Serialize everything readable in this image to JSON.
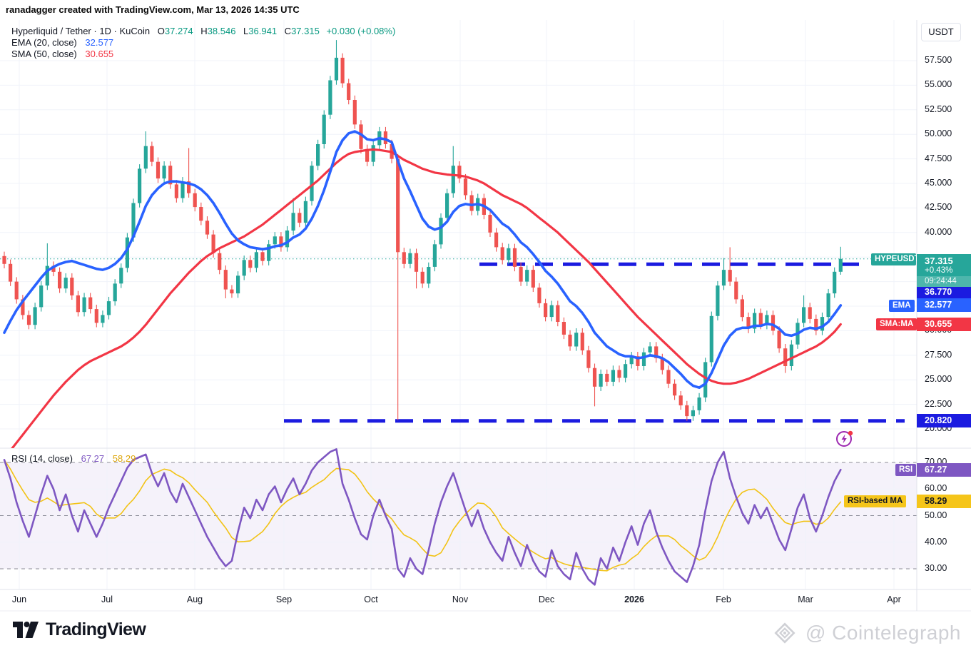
{
  "attribution": "ranadagger created with TradingView.com, Mar 13, 2026 14:35 UTC",
  "header": {
    "symbol_title": "Hyperliquid / Tether · 1D · KuCoin",
    "ohlc": {
      "o_label": "O",
      "o": "37.274",
      "h_label": "H",
      "h": "38.546",
      "l_label": "L",
      "l": "36.941",
      "c_label": "C",
      "c": "37.315",
      "change": "+0.030 (+0.08%)"
    },
    "ema_legend": {
      "name": "EMA (20, close)",
      "value": "32.577"
    },
    "sma_legend": {
      "name": "SMA (50, close)",
      "value": "30.655"
    }
  },
  "rsi_legend": {
    "name": "RSI (14, close)",
    "value": "67.27",
    "ma_value": "58.29"
  },
  "price_axis": {
    "currency_button": "USDT",
    "ticks": [
      {
        "label": "57.500",
        "value": 57.5
      },
      {
        "label": "55.000",
        "value": 55
      },
      {
        "label": "52.500",
        "value": 52.5
      },
      {
        "label": "50.000",
        "value": 50
      },
      {
        "label": "47.500",
        "value": 47.5
      },
      {
        "label": "45.000",
        "value": 45
      },
      {
        "label": "42.500",
        "value": 42.5
      },
      {
        "label": "40.000",
        "value": 40
      },
      {
        "label": "30.000",
        "value": 30
      },
      {
        "label": "27.500",
        "value": 27.5
      },
      {
        "label": "25.000",
        "value": 25
      },
      {
        "label": "22.500",
        "value": 22.5
      },
      {
        "label": "20.000",
        "value": 20
      }
    ],
    "price_label": {
      "tag": "HYPEUSDT",
      "price": "37.315",
      "change_pct": "+0.43%",
      "countdown": "09:24:44",
      "value": 37.315
    },
    "line_label": {
      "price": "36.770",
      "value": 36.77
    },
    "ema_label": {
      "tag": "EMA",
      "price": "32.577",
      "value": 32.577
    },
    "sma_label": {
      "tag": "SMA:MA",
      "price": "30.655",
      "value": 30.655
    },
    "support_label": {
      "price": "20.820",
      "value": 20.82
    }
  },
  "rsi_axis": {
    "ticks": [
      {
        "label": "70.00",
        "value": 70
      },
      {
        "label": "60.00",
        "value": 60
      },
      {
        "label": "50.00",
        "value": 50
      },
      {
        "label": "40.00",
        "value": 40
      },
      {
        "label": "30.00",
        "value": 30
      }
    ],
    "rsi_label": {
      "tag": "RSI",
      "value": "67.27",
      "num": 67.27
    },
    "ma_label": {
      "tag": "RSI-based MA",
      "value": "58.29",
      "num": 55.5
    }
  },
  "time_axis": {
    "labels": [
      {
        "label": "Jun",
        "bold": false
      },
      {
        "label": "Jul",
        "bold": false
      },
      {
        "label": "Aug",
        "bold": false
      },
      {
        "label": "Sep",
        "bold": false
      },
      {
        "label": "Oct",
        "bold": false
      },
      {
        "label": "Nov",
        "bold": false
      },
      {
        "label": "Dec",
        "bold": false
      },
      {
        "label": "2026",
        "bold": true
      },
      {
        "label": "Feb",
        "bold": false
      },
      {
        "label": "Mar",
        "bold": false
      },
      {
        "label": "Apr",
        "bold": false
      }
    ]
  },
  "footer": {
    "logo_text": "TradingView",
    "watermark": "@ Cointelegraph"
  },
  "colors": {
    "up": "#26a69a",
    "down": "#ef5350",
    "header_value": "#089981",
    "ema": "#2962ff",
    "sma": "#f23645",
    "drawing_blue": "#1b1be0",
    "rsi": "#7e57c2",
    "rsi_ma": "#f0b90b",
    "rsi_ma_label_bg": "#f5c51a",
    "grid": "#f0f3fa",
    "band_dash": "#787b86",
    "axis_text": "#131722",
    "price_tag_bg": "#26a69a",
    "watermark_gray": "#cfd0d5"
  },
  "chart_data": {
    "type": "candlestick",
    "symbol": "HYPEUSDT",
    "exchange": "KuCoin",
    "interval": "1D",
    "title": "Hyperliquid / Tether · 1D · KuCoin",
    "ylim": [
      18,
      60.5
    ],
    "price_gridlines": [
      20,
      22.5,
      25,
      27.5,
      30,
      32.5,
      35,
      37.5,
      40,
      42.5,
      45,
      47.5,
      50,
      52.5,
      55,
      57.5
    ],
    "x_months": [
      "Jun",
      "Jul",
      "Aug",
      "Sep",
      "Oct",
      "Nov",
      "Dec",
      "2026",
      "Feb",
      "Mar",
      "Apr"
    ],
    "last_ohlc": {
      "open": 37.274,
      "high": 38.546,
      "low": 36.941,
      "close": 37.315,
      "change": 0.03,
      "change_pct": 0.08
    },
    "levels": {
      "resistance": 36.77,
      "support": 20.82,
      "last_price": 37.315
    },
    "candles": {
      "first_open": 37.6,
      "default_wick": 0.45,
      "closes": [
        36.8,
        35.0,
        33.2,
        31.6,
        30.6,
        32.4,
        34.6,
        36.6,
        36.0,
        34.3,
        35.4,
        33.6,
        31.9,
        33.4,
        32.2,
        30.8,
        31.6,
        33.0,
        34.8,
        36.4,
        39.5,
        43.0,
        46.5,
        48.8,
        47.2,
        45.5,
        46.8,
        44.9,
        43.5,
        45.2,
        44.0,
        42.6,
        41.2,
        39.8,
        37.9,
        36.2,
        34.2,
        33.8,
        35.6,
        37.2,
        36.4,
        38.0,
        37.1,
        38.8,
        39.6,
        38.5,
        40.2,
        42.0,
        41.0,
        43.2,
        46.8,
        49.0,
        52.0,
        55.5,
        57.8,
        55.2,
        53.5,
        51.0,
        48.5,
        47.2,
        48.9,
        50.3,
        49.0,
        47.5,
        38.0,
        36.8,
        37.9,
        36.0,
        34.8,
        36.5,
        38.8,
        41.5,
        44.0,
        46.8,
        45.5,
        43.8,
        42.2,
        43.5,
        41.8,
        40.0,
        38.5,
        37.2,
        38.4,
        36.5,
        35.0,
        36.2,
        34.4,
        32.8,
        31.4,
        32.6,
        30.9,
        29.6,
        28.4,
        29.8,
        28.0,
        26.2,
        24.3,
        25.6,
        24.8,
        26.0,
        25.2,
        26.6,
        27.4,
        26.4,
        27.8,
        28.4,
        27.2,
        26.0,
        24.6,
        23.4,
        22.4,
        21.3,
        21.9,
        23.2,
        26.8,
        31.5,
        34.6,
        36.2,
        35.0,
        33.2,
        31.4,
        30.2,
        31.8,
        30.6,
        31.6,
        30.0,
        28.2,
        26.4,
        28.6,
        30.8,
        32.4,
        31.2,
        30.0,
        31.4,
        33.8,
        36.0,
        37.315
      ],
      "wick_overrides": {
        "7": {
          "h": 38.9
        },
        "23": {
          "h": 50.3
        },
        "30": {
          "h": 48.6
        },
        "36": {
          "l": 33.3
        },
        "47": {
          "h": 43.5
        },
        "54": {
          "h": 59.6
        },
        "64": {
          "l": 20.9,
          "h": 48.0
        },
        "67": {
          "l": 34.3
        },
        "73": {
          "h": 48.8
        },
        "96": {
          "l": 22.3
        },
        "111": {
          "l": 20.82
        },
        "112": {
          "l": 20.82
        },
        "117": {
          "h": 37.4
        },
        "118": {
          "h": 38.5
        },
        "127": {
          "l": 25.7
        },
        "130": {
          "h": 33.6
        },
        "136": {
          "h": 38.546,
          "l": 35.7
        }
      }
    },
    "ema20": [
      29.8,
      31.0,
      32.1,
      33.0,
      33.8,
      34.6,
      35.4,
      36.1,
      36.5,
      36.8,
      37.0,
      37.1,
      36.9,
      36.7,
      36.5,
      36.3,
      36.2,
      36.4,
      36.8,
      37.4,
      38.3,
      39.6,
      41.1,
      42.7,
      43.8,
      44.5,
      45.0,
      45.2,
      45.2,
      45.1,
      45.0,
      44.8,
      44.4,
      43.8,
      43.0,
      42.0,
      40.9,
      39.9,
      39.2,
      38.8,
      38.5,
      38.4,
      38.3,
      38.4,
      38.6,
      38.7,
      39.0,
      39.5,
      39.8,
      40.4,
      41.4,
      42.7,
      44.3,
      46.2,
      48.2,
      49.4,
      50.1,
      50.3,
      50.0,
      49.5,
      49.4,
      49.6,
      49.5,
      49.2,
      47.3,
      45.5,
      44.2,
      42.8,
      41.4,
      40.6,
      40.3,
      40.5,
      41.1,
      42.1,
      42.7,
      42.9,
      42.8,
      42.9,
      42.7,
      42.3,
      41.6,
      40.9,
      40.5,
      39.8,
      39.0,
      38.5,
      37.8,
      37.0,
      36.1,
      35.5,
      34.8,
      33.9,
      33.0,
      32.5,
      31.8,
      30.9,
      29.8,
      29.1,
      28.4,
      28.0,
      27.6,
      27.4,
      27.4,
      27.2,
      27.3,
      27.5,
      27.4,
      27.2,
      26.8,
      26.2,
      25.6,
      24.9,
      24.4,
      24.2,
      24.6,
      25.7,
      27.1,
      28.5,
      29.5,
      30.1,
      30.3,
      30.3,
      30.5,
      30.5,
      30.7,
      30.6,
      30.2,
      29.6,
      29.5,
      29.7,
      30.1,
      30.3,
      30.2,
      30.4,
      30.9,
      31.7,
      32.577
    ],
    "sma50": [
      17.0,
      17.8,
      18.6,
      19.4,
      20.2,
      21.0,
      21.8,
      22.6,
      23.4,
      24.1,
      24.8,
      25.4,
      26.0,
      26.5,
      26.9,
      27.2,
      27.5,
      27.8,
      28.1,
      28.4,
      28.8,
      29.3,
      29.9,
      30.6,
      31.4,
      32.2,
      33.0,
      33.8,
      34.5,
      35.2,
      35.9,
      36.5,
      37.1,
      37.6,
      38.0,
      38.4,
      38.7,
      39.0,
      39.3,
      39.6,
      40.0,
      40.4,
      40.8,
      41.3,
      41.8,
      42.3,
      42.8,
      43.3,
      43.8,
      44.3,
      44.8,
      45.3,
      45.9,
      46.5,
      47.1,
      47.6,
      48.0,
      48.2,
      48.3,
      48.4,
      48.45,
      48.4,
      48.3,
      48.2,
      47.8,
      47.4,
      47.1,
      46.8,
      46.5,
      46.3,
      46.1,
      46.0,
      45.9,
      45.85,
      45.8,
      45.7,
      45.5,
      45.3,
      45.0,
      44.6,
      44.2,
      43.8,
      43.5,
      43.2,
      42.9,
      42.5,
      42.0,
      41.5,
      41.0,
      40.5,
      40.0,
      39.4,
      38.8,
      38.2,
      37.6,
      37.0,
      36.3,
      35.6,
      34.9,
      34.2,
      33.5,
      32.8,
      32.1,
      31.4,
      30.8,
      30.2,
      29.6,
      29.0,
      28.4,
      27.8,
      27.2,
      26.6,
      26.1,
      25.6,
      25.2,
      24.9,
      24.7,
      24.6,
      24.6,
      24.7,
      24.9,
      25.1,
      25.4,
      25.7,
      26.0,
      26.3,
      26.6,
      26.9,
      27.2,
      27.5,
      27.8,
      28.1,
      28.4,
      28.8,
      29.3,
      29.9,
      30.655
    ],
    "rsi14": [
      71,
      64,
      55,
      48,
      42,
      50,
      58,
      65,
      60,
      52,
      58,
      50,
      44,
      52,
      47,
      42,
      47,
      53,
      58,
      63,
      68,
      71,
      72,
      73,
      66,
      61,
      66,
      59,
      55,
      62,
      57,
      52,
      47,
      42,
      38,
      34,
      31,
      33,
      44,
      53,
      49,
      56,
      52,
      58,
      61,
      55,
      60,
      64,
      58,
      62,
      67,
      70,
      72,
      74,
      75,
      62,
      56,
      49,
      43,
      41,
      50,
      56,
      50,
      45,
      30,
      27,
      34,
      30,
      28,
      37,
      47,
      55,
      61,
      66,
      59,
      52,
      46,
      52,
      45,
      40,
      36,
      33,
      42,
      36,
      31,
      39,
      33,
      29,
      27,
      37,
      31,
      28,
      26,
      36,
      30,
      26,
      24,
      34,
      30,
      38,
      33,
      40,
      46,
      39,
      47,
      52,
      44,
      38,
      33,
      29,
      27,
      25,
      31,
      39,
      52,
      63,
      70,
      74,
      64,
      57,
      51,
      47,
      54,
      49,
      53,
      47,
      41,
      37,
      45,
      53,
      58,
      49,
      44,
      50,
      57,
      63,
      67.27
    ],
    "rsi_band": [
      30,
      70
    ],
    "rsi_dashed_gridlines": [
      30,
      50,
      70
    ],
    "rsi_solid_gridlines": [
      40,
      60
    ],
    "legend_position": "top-left",
    "grid": true
  }
}
